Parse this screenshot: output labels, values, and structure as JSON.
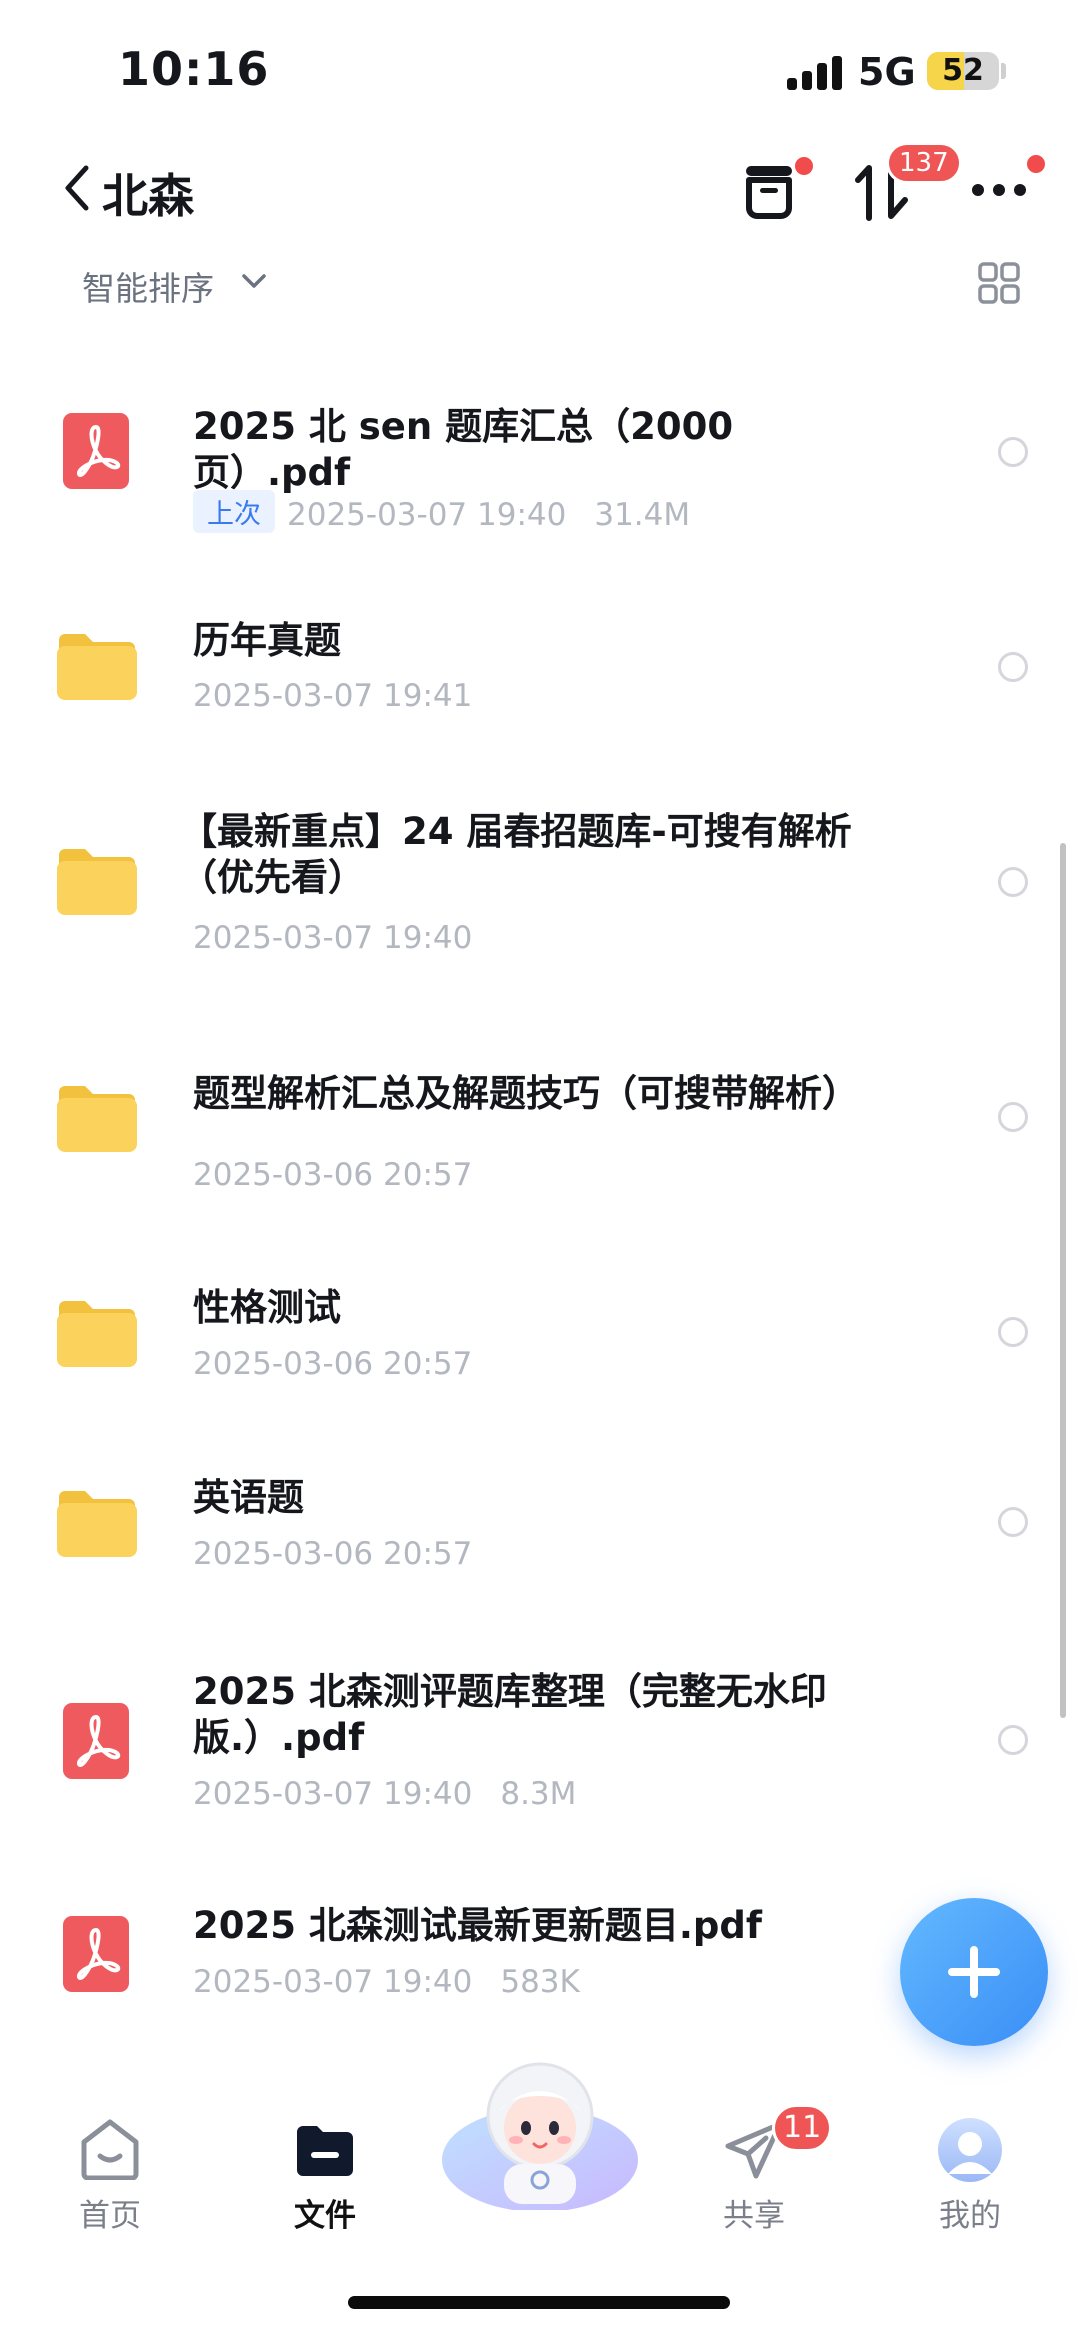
{
  "status_bar": {
    "time": "10:16",
    "network": "5G",
    "battery": "52",
    "battery_level": 0.52
  },
  "header": {
    "title": "北森",
    "transfer_badge": "137"
  },
  "sort": {
    "label": "智能排序"
  },
  "files": [
    {
      "type": "pdf",
      "name": "2025 北 sen 题库汇总（2000 页）.pdf",
      "tag": "上次",
      "date": "2025-03-07 19:40",
      "size": "31.4M"
    },
    {
      "type": "folder",
      "name": "历年真题",
      "date": "2025-03-07 19:41"
    },
    {
      "type": "folder",
      "name": "【最新重点】24 届春招题库-可搜有解析（优先看）",
      "date": "2025-03-07 19:40"
    },
    {
      "type": "folder",
      "name": "题型解析汇总及解题技巧（可搜带解析）",
      "date": "2025-03-06 20:57"
    },
    {
      "type": "folder",
      "name": "性格测试",
      "date": "2025-03-06 20:57"
    },
    {
      "type": "folder",
      "name": "英语题",
      "date": "2025-03-06 20:57"
    },
    {
      "type": "pdf",
      "name": "2025 北森测评题库整理（完整无水印版.）.pdf",
      "date": "2025-03-07 19:40",
      "size": "8.3M"
    },
    {
      "type": "pdf",
      "name": "2025 北森测试最新更新题目.pdf",
      "date": "2025-03-07 19:40",
      "size": "583K"
    }
  ],
  "tabbar": {
    "home": "首页",
    "files": "文件",
    "share": "共享",
    "share_badge": "11",
    "mine": "我的"
  },
  "colors": {
    "pdf": "#ee5a5e",
    "folder": "#fbd25c",
    "fab": "#3a8ef6",
    "badge": "#f05555"
  }
}
